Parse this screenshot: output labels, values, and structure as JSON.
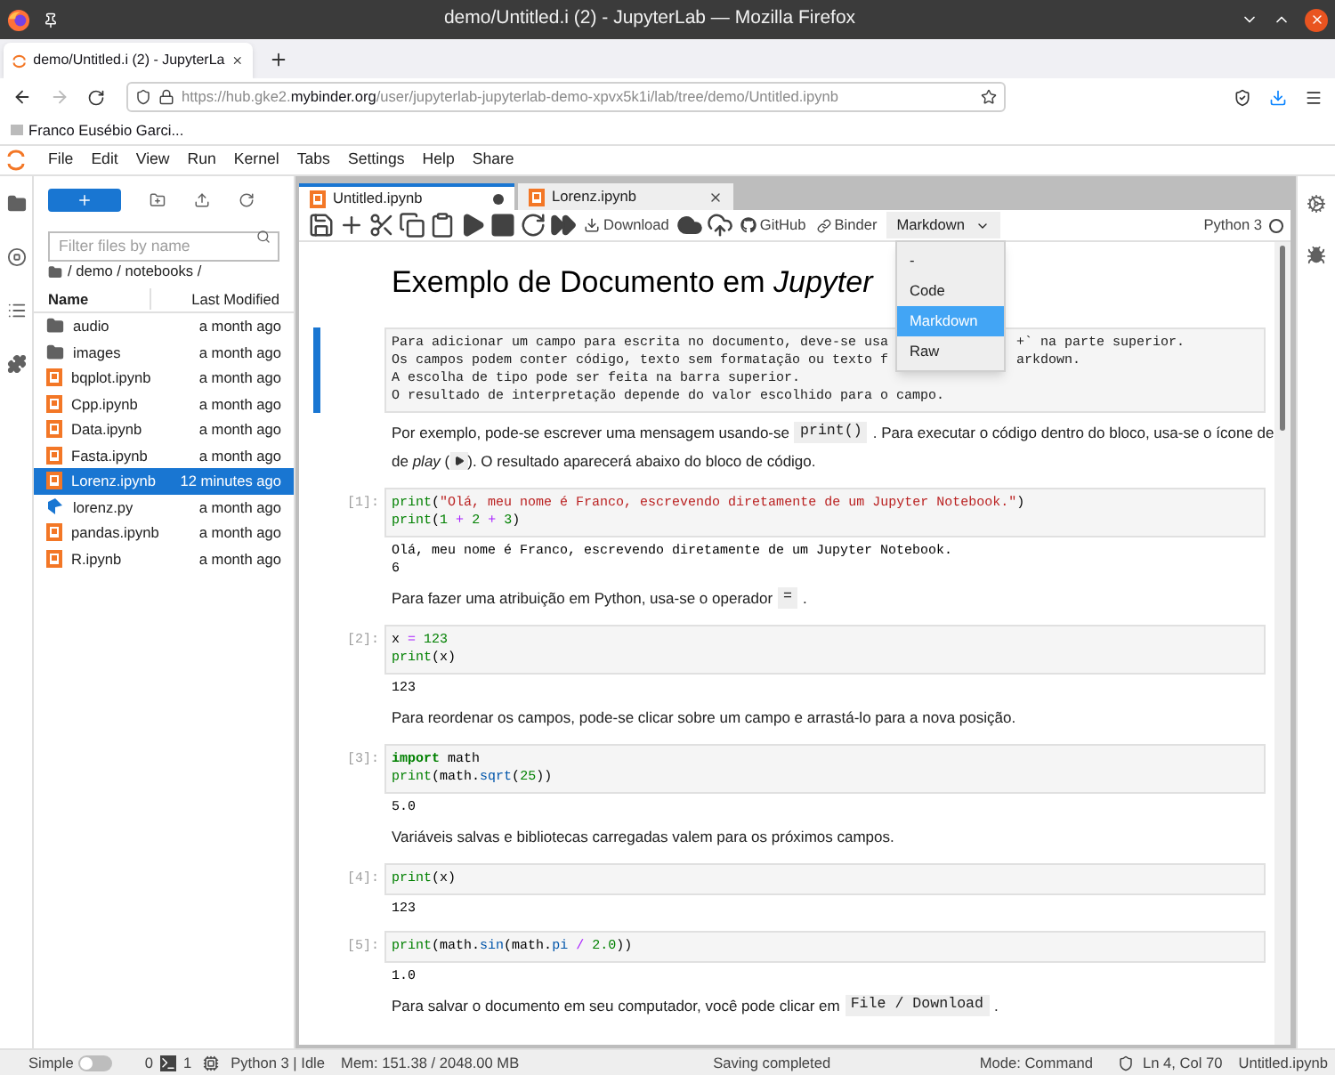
{
  "window": {
    "title": "demo/Untitled.i (2) - JupyterLab — Mozilla Firefox"
  },
  "browser": {
    "tabs": [
      {
        "label": "demo/Untitled.i (2) - JupyterLa",
        "selected": true
      }
    ],
    "url": {
      "prefix": "https://hub.gke2.",
      "domain": "mybinder.org",
      "path": "/user/jupyterlab-jupyterlab-demo-xpvx5k1i/lab/tree/demo/Untitled.ipynb"
    },
    "bookmarks": [
      {
        "label": "Franco Eusébio Garci..."
      }
    ]
  },
  "menu": [
    "File",
    "Edit",
    "View",
    "Run",
    "Kernel",
    "Tabs",
    "Settings",
    "Help",
    "Share"
  ],
  "file_browser": {
    "filter": {
      "placeholder": "Filter files by name"
    },
    "breadcrumb": "/ demo / notebooks /",
    "columns": [
      "Name",
      "Last Modified"
    ],
    "rows": [
      {
        "kind": "folder",
        "name": "audio",
        "modified": "a month ago",
        "selected": false
      },
      {
        "kind": "folder",
        "name": "images",
        "modified": "a month ago",
        "selected": false
      },
      {
        "kind": "notebook",
        "name": "bqplot.ipynb",
        "modified": "a month ago",
        "selected": false
      },
      {
        "kind": "notebook",
        "name": "Cpp.ipynb",
        "modified": "a month ago",
        "selected": false
      },
      {
        "kind": "notebook",
        "name": "Data.ipynb",
        "modified": "a month ago",
        "selected": false
      },
      {
        "kind": "notebook",
        "name": "Fasta.ipynb",
        "modified": "a month ago",
        "selected": false
      },
      {
        "kind": "notebook",
        "name": "Lorenz.ipynb",
        "modified": "12 minutes ago",
        "selected": true
      },
      {
        "kind": "python",
        "name": "lorenz.py",
        "modified": "a month ago",
        "selected": false
      },
      {
        "kind": "notebook",
        "name": "pandas.ipynb",
        "modified": "a month ago",
        "selected": false
      },
      {
        "kind": "notebook",
        "name": "R.ipynb",
        "modified": "a month ago",
        "selected": false
      }
    ]
  },
  "doc_tabs": [
    {
      "label": "Untitled.ipynb",
      "selected": true,
      "dirty": true
    },
    {
      "label": "Lorenz.ipynb",
      "selected": false,
      "dirty": false
    }
  ],
  "toolbar": {
    "download": "Download",
    "github": "GitHub",
    "binder": "Binder",
    "cell_type": "Markdown",
    "kernel": "Python 3",
    "cell_type_options": [
      {
        "label": "-",
        "selected": false
      },
      {
        "label": "Code",
        "selected": false
      },
      {
        "label": "Markdown",
        "selected": true
      },
      {
        "label": "Raw",
        "selected": false
      }
    ]
  },
  "cells": [
    {
      "kind": "heading",
      "selected": false,
      "text": "Exemplo de Documento em *Jupyter*"
    },
    {
      "kind": "raw",
      "selected": true,
      "lines": [
        [
          "Para adicionar um campo para escrita no documento, deve-se usa",
          "+` na parte superior."
        ],
        [
          "Os campos podem conter código, texto sem formatação ou texto f",
          "arkdown."
        ],
        [
          "A escolha de tipo pode ser feita na barra superior."
        ],
        [
          "O resultado de interpretação depende do valor escolhido para o campo."
        ]
      ]
    },
    {
      "kind": "text",
      "selected": false,
      "lines": [
        [
          {
            "kind": "text",
            "text": "Por exemplo, pode-se escrever uma mensagem usando-se"
          },
          {
            "kind": "code",
            "text": "print()"
          },
          {
            "kind": "text",
            "text": ". Para executar o código dentro do bloco, usa-se o ícone de"
          }
        ],
        [
          {
            "kind": "text",
            "text": "de *play* ("
          },
          {
            "kind": "play"
          },
          {
            "kind": "text",
            "text": "). O resultado aparecerá abaixo do bloco de código."
          }
        ]
      ]
    },
    {
      "kind": "code",
      "selected": false,
      "prompt": "[1]:",
      "lines": [
        [
          {
            "kind": "builtin",
            "text": "print"
          },
          {
            "kind": "plain",
            "text": "("
          },
          {
            "kind": "string",
            "text": "\"Olá, meu nome é Franco, escrevendo diretamente de um Jupyter Notebook.\""
          },
          {
            "kind": "plain",
            "text": ")"
          }
        ],
        [
          {
            "kind": "builtin",
            "text": "print"
          },
          {
            "kind": "plain",
            "text": "("
          },
          {
            "kind": "number",
            "text": "1"
          },
          {
            "kind": "operator",
            "text": " + "
          },
          {
            "kind": "number",
            "text": "2"
          },
          {
            "kind": "operator",
            "text": " + "
          },
          {
            "kind": "number",
            "text": "3"
          },
          {
            "kind": "plain",
            "text": ")"
          }
        ]
      ],
      "output": [
        "Olá, meu nome é Franco, escrevendo diretamente de um Jupyter Notebook.",
        "6"
      ]
    },
    {
      "kind": "text",
      "selected": false,
      "lines": [
        [
          {
            "kind": "text",
            "text": "Para fazer uma atribuição em Python, usa-se o operador"
          },
          {
            "kind": "code",
            "text": "="
          },
          {
            "kind": "text",
            "text": "."
          }
        ]
      ]
    },
    {
      "kind": "code",
      "selected": false,
      "prompt": "[2]:",
      "lines": [
        [
          {
            "kind": "plain",
            "text": "x"
          },
          {
            "kind": "operator",
            "text": " = "
          },
          {
            "kind": "number",
            "text": "123"
          }
        ],
        [
          {
            "kind": "builtin",
            "text": "print"
          },
          {
            "kind": "plain",
            "text": "(x)"
          }
        ]
      ],
      "output": [
        "123"
      ]
    },
    {
      "kind": "text",
      "selected": false,
      "lines": [
        [
          {
            "kind": "text",
            "text": "Para reordenar os campos, pode-se clicar sobre um campo e arrastá-lo para a nova posição."
          }
        ]
      ]
    },
    {
      "kind": "code",
      "selected": false,
      "prompt": "[3]:",
      "lines": [
        [
          {
            "kind": "keyword",
            "text": "import"
          },
          {
            "kind": "plain",
            "text": " math"
          }
        ],
        [
          {
            "kind": "builtin",
            "text": "print"
          },
          {
            "kind": "plain",
            "text": "(math."
          },
          {
            "kind": "attribute",
            "text": "sqrt"
          },
          {
            "kind": "plain",
            "text": "("
          },
          {
            "kind": "number",
            "text": "25"
          },
          {
            "kind": "plain",
            "text": "))"
          }
        ]
      ],
      "output": [
        "5.0"
      ]
    },
    {
      "kind": "text",
      "selected": false,
      "lines": [
        [
          {
            "kind": "text",
            "text": "Variáveis salvas e bibliotecas carregadas valem para os próximos campos."
          }
        ]
      ]
    },
    {
      "kind": "code",
      "selected": false,
      "prompt": "[4]:",
      "lines": [
        [
          {
            "kind": "builtin",
            "text": "print"
          },
          {
            "kind": "plain",
            "text": "(x)"
          }
        ]
      ],
      "output": [
        "123"
      ]
    },
    {
      "kind": "code",
      "selected": false,
      "prompt": "[5]:",
      "lines": [
        [
          {
            "kind": "builtin",
            "text": "print"
          },
          {
            "kind": "plain",
            "text": "(math."
          },
          {
            "kind": "attribute",
            "text": "sin"
          },
          {
            "kind": "plain",
            "text": "(math."
          },
          {
            "kind": "attribute",
            "text": "pi"
          },
          {
            "kind": "operator",
            "text": " / "
          },
          {
            "kind": "number",
            "text": "2.0"
          },
          {
            "kind": "plain",
            "text": "))"
          }
        ]
      ],
      "output": [
        "1.0"
      ]
    },
    {
      "kind": "text",
      "selected": false,
      "lines": [
        [
          {
            "kind": "text",
            "text": "Para salvar o documento em seu computador, você pode clicar em"
          },
          {
            "kind": "code",
            "text": "File / Download"
          },
          {
            "kind": "text",
            "text": "."
          }
        ]
      ]
    }
  ],
  "status_bar": {
    "simple_mode": {
      "label": "Simple",
      "on": false
    },
    "terminals": "0",
    "kernels": "1",
    "kernel_status": "Python 3 | Idle",
    "memory": "Mem: 151.38 / 2048.00 MB",
    "message": "Saving completed",
    "mode": "Mode: Command",
    "position": "Ln 4, Col 70",
    "file": "Untitled.ipynb"
  }
}
